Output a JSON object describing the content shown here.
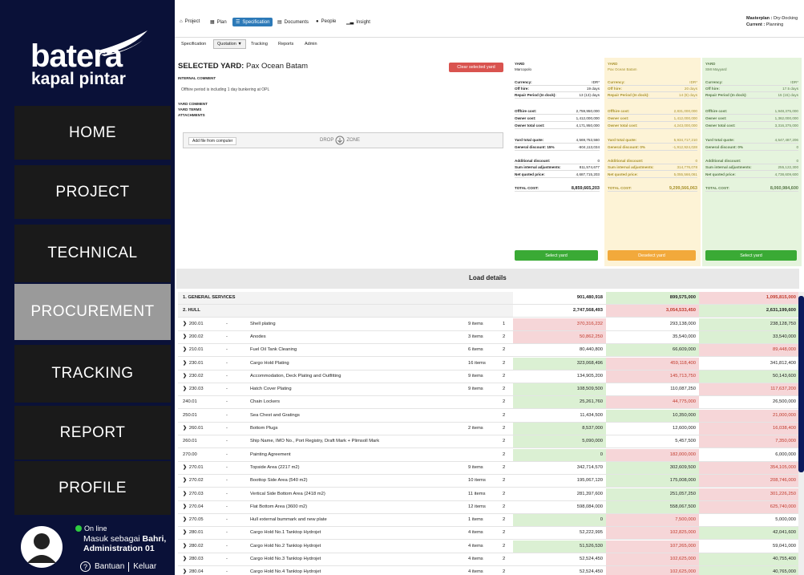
{
  "sidebar": {
    "logo_line1": "batera",
    "logo_line2": "kapal pintar",
    "items": [
      {
        "label": "HOME",
        "active": false
      },
      {
        "label": "PROJECT",
        "active": false
      },
      {
        "label": "TECHNICAL",
        "active": false
      },
      {
        "label": "PROCUREMENT",
        "active": true
      },
      {
        "label": "TRACKING",
        "active": false
      },
      {
        "label": "REPORT",
        "active": false
      },
      {
        "label": "PROFILE",
        "active": false
      }
    ],
    "user": {
      "status": "On line",
      "login_prefix": "Masuk sebagai",
      "login_name": "Bahri,",
      "login_role": "Administration 01",
      "help": "Bantuan",
      "logout": "Keluar"
    }
  },
  "topnav": {
    "tabs": [
      "Project",
      "Plan",
      "Specification",
      "Documents",
      "People",
      "Insight"
    ],
    "active": "Specification",
    "masterplan_label": "Masterplan :",
    "masterplan_value": "Dry-Docking",
    "current_label": "Current :",
    "current_value": "Planning"
  },
  "subtabs": [
    "Specification",
    "Quotation ▼",
    "Tracking",
    "Reports",
    "Admin"
  ],
  "left": {
    "selected_label": "SELECTED YARD:",
    "selected_value": "Pax Ocean Batam",
    "clear_button": "Clear selected yard",
    "internal_comment_label": "INTERNAL COMMENT",
    "internal_comment": "Offhire period is including 1 day bunkering at OPL",
    "yard_comment_label": "YARD COMMENT",
    "yard_terms_label": "YARD TERMS",
    "attachments_label": "ATTACHMENTS",
    "add_file": "Add file from computer",
    "drop_zone_left": "DROP",
    "drop_zone_right": "ZONE"
  },
  "yards": [
    {
      "label": "YARD",
      "name": "Marcopolo",
      "rows": [
        [
          "Currency:",
          "IDR*"
        ],
        [
          "Off hire:",
          "19 days"
        ],
        [
          "Repair Period (In dock):",
          "13 (13) days"
        ],
        [
          "Offhire cost:",
          "2,759,950,000"
        ],
        [
          "Owner cost:",
          "1,412,000,000"
        ],
        [
          "Owner total cost:",
          "4,171,950,000"
        ],
        [
          "Yard total quote:",
          "4,569,753,560"
        ],
        [
          "General discount: 15%",
          "-604,113,034"
        ],
        [
          "Additional discount:",
          "0"
        ],
        [
          "Sum internal adjustments:",
          "811,574,677"
        ],
        [
          "Net quoted price:",
          "4,687,715,203"
        ],
        [
          "TOTAL COST:",
          "8,859,665,203"
        ]
      ],
      "button": "Select yard"
    },
    {
      "label": "YARD",
      "name": "Pax Ocean Batam",
      "rows": [
        [
          "Currency:",
          "IDR*"
        ],
        [
          "Off hire:",
          "20 days"
        ],
        [
          "Repair Period (In dock):",
          "14 (8) days"
        ],
        [
          "Offhire cost:",
          "2,831,000,000"
        ],
        [
          "Owner cost:",
          "1,412,000,000"
        ],
        [
          "Owner total cost:",
          "4,243,000,000"
        ],
        [
          "Yard total quote:",
          "5,934,717,210"
        ],
        [
          "General discount: 0%",
          "-1,912,924,028"
        ],
        [
          "Additional discount:",
          "0"
        ],
        [
          "Sum internal adjustments:",
          "314,776,078"
        ],
        [
          "Net quoted price:",
          "5,055,566,061"
        ],
        [
          "TOTAL COST:",
          "9,299,566,063"
        ]
      ],
      "button": "Deselect yard"
    },
    {
      "label": "YARD",
      "name": "SMI Mayyard",
      "rows": [
        [
          "Currency:",
          "IDR*"
        ],
        [
          "Off hire:",
          "17.5 days"
        ],
        [
          "Repair Period (In dock):",
          "15 (15) days"
        ],
        [
          "Offhire cost:",
          "1,948,375,000"
        ],
        [
          "Owner cost:",
          "1,362,000,000"
        ],
        [
          "Owner total cost:",
          "3,316,375,000"
        ],
        [
          "Yard total quote:",
          "4,547,487,206"
        ],
        [
          "General discount: 0%",
          "0"
        ],
        [
          "Additional discount:",
          "0"
        ],
        [
          "Sum internal adjustments:",
          "255,122,300"
        ],
        [
          "Net quoted price:",
          "4,738,609,600"
        ],
        [
          "TOTAL COST:",
          "8,060,984,600"
        ]
      ],
      "button": "Select yard"
    }
  ],
  "load_details": "Load details",
  "table": {
    "rows": [
      {
        "type": "hdr",
        "code": "1. GENERAL SERVICES",
        "v": [
          "901,480,918",
          "899,575,000",
          "1,095,815,000"
        ],
        "c": [
          "wht",
          "grn",
          "red"
        ]
      },
      {
        "type": "hdr",
        "code": "2. HULL",
        "v": [
          "2,747,568,493",
          "3,054,533,450",
          "2,631,199,600"
        ],
        "c": [
          "wht",
          "red",
          "grn"
        ]
      },
      {
        "type": "row",
        "chev": true,
        "code": "200.01",
        "desc": "Shell plating",
        "items": "9 items",
        "cnt": "1",
        "v": [
          "370,316,232",
          "293,138,000",
          "238,128,750"
        ],
        "c": [
          "red",
          "wht",
          "grn"
        ]
      },
      {
        "type": "row",
        "chev": true,
        "code": "200.02",
        "desc": "Anodes",
        "items": "3 items",
        "cnt": "2",
        "v": [
          "50,862,250",
          "35,540,000",
          "33,540,000"
        ],
        "c": [
          "red",
          "wht",
          "grn"
        ]
      },
      {
        "type": "row",
        "chev": true,
        "code": "210.01",
        "desc": "Fuel Oil Tank Cleaning",
        "items": "6 items",
        "cnt": "2",
        "v": [
          "80,440,800",
          "66,609,000",
          "89,448,000"
        ],
        "c": [
          "wht",
          "grn",
          "red"
        ]
      },
      {
        "type": "row",
        "chev": true,
        "code": "230.01",
        "desc": "Cargo Hold Plating",
        "items": "16 items",
        "cnt": "2",
        "v": [
          "323,068,496",
          "459,118,400",
          "341,812,400"
        ],
        "c": [
          "grn",
          "red",
          "wht"
        ]
      },
      {
        "type": "row",
        "chev": true,
        "code": "230.02",
        "desc": "Accommodation, Deck Plating and Outfitting",
        "items": "9 items",
        "cnt": "2",
        "v": [
          "134,905,200",
          "145,713,750",
          "50,143,600"
        ],
        "c": [
          "wht",
          "red",
          "grn"
        ]
      },
      {
        "type": "row",
        "chev": true,
        "code": "230.03",
        "desc": "Hatch Cover Plating",
        "items": "9 items",
        "cnt": "2",
        "v": [
          "108,509,500",
          "110,087,250",
          "117,637,200"
        ],
        "c": [
          "grn",
          "wht",
          "red"
        ]
      },
      {
        "type": "row",
        "chev": false,
        "code": "240.01",
        "desc": "Chain Lockers",
        "items": "",
        "cnt": "2",
        "v": [
          "25,261,760",
          "44,775,000",
          "26,500,000"
        ],
        "c": [
          "grn",
          "red",
          "wht"
        ]
      },
      {
        "type": "row",
        "chev": false,
        "code": "250.01",
        "desc": "Sea Chest and Gratings",
        "items": "",
        "cnt": "2",
        "v": [
          "11,434,500",
          "10,350,000",
          "21,000,000"
        ],
        "c": [
          "wht",
          "grn",
          "red"
        ]
      },
      {
        "type": "row",
        "chev": true,
        "code": "260.01",
        "desc": "Bottom Plugs",
        "items": "2 items",
        "cnt": "2",
        "v": [
          "8,537,000",
          "12,600,000",
          "16,038,400"
        ],
        "c": [
          "grn",
          "wht",
          "red"
        ]
      },
      {
        "type": "row",
        "chev": false,
        "code": "260.01",
        "desc": "Ship Name, IMO No., Port Registry, Draft Mark + Plimsoll Mark",
        "items": "",
        "cnt": "2",
        "v": [
          "5,090,000",
          "5,457,500",
          "7,350,000"
        ],
        "c": [
          "grn",
          "wht",
          "red"
        ]
      },
      {
        "type": "row",
        "chev": false,
        "code": "270.00",
        "desc": "Painting Agreement",
        "items": "",
        "cnt": "2",
        "v": [
          "0",
          "182,000,000",
          "6,000,000"
        ],
        "c": [
          "grn",
          "red",
          "wht"
        ]
      },
      {
        "type": "row",
        "chev": true,
        "code": "270.01",
        "desc": "Topside Area (2217 m2)",
        "items": "9 items",
        "cnt": "2",
        "v": [
          "342,714,570",
          "302,609,500",
          "354,105,000"
        ],
        "c": [
          "wht",
          "grn",
          "red"
        ]
      },
      {
        "type": "row",
        "chev": true,
        "code": "270.02",
        "desc": "Boottop Side Area (540 m2)",
        "items": "10 items",
        "cnt": "2",
        "v": [
          "195,067,120",
          "175,008,000",
          "208,746,000"
        ],
        "c": [
          "wht",
          "grn",
          "red"
        ]
      },
      {
        "type": "row",
        "chev": true,
        "code": "270.03",
        "desc": "Vertical Side Bottom Area (2418 m2)",
        "items": "11 items",
        "cnt": "2",
        "v": [
          "281,397,600",
          "251,057,250",
          "301,226,250"
        ],
        "c": [
          "wht",
          "grn",
          "red"
        ]
      },
      {
        "type": "row",
        "chev": true,
        "code": "270.04",
        "desc": "Flat Bottom Area (3600 m2)",
        "items": "12 items",
        "cnt": "2",
        "v": [
          "598,084,000",
          "558,067,500",
          "625,740,000"
        ],
        "c": [
          "wht",
          "grn",
          "red"
        ]
      },
      {
        "type": "row",
        "chev": true,
        "code": "270.05",
        "desc": "Hull external bummark and new plate",
        "items": "1 items",
        "cnt": "2",
        "v": [
          "0",
          "7,500,000",
          "5,000,000"
        ],
        "c": [
          "grn",
          "red",
          "wht"
        ]
      },
      {
        "type": "row",
        "chev": true,
        "code": "280.01",
        "desc": "Cargo Hold No.1 Tanktop Hydrojet",
        "items": "4 items",
        "cnt": "2",
        "v": [
          "52,222,995",
          "102,825,000",
          "42,041,600"
        ],
        "c": [
          "wht",
          "red",
          "grn"
        ]
      },
      {
        "type": "row",
        "chev": true,
        "code": "280.02",
        "desc": "Cargo Hold No.2 Tanktop Hydrojet",
        "items": "4 items",
        "cnt": "2",
        "v": [
          "51,526,530",
          "107,265,000",
          "59,041,000"
        ],
        "c": [
          "grn",
          "red",
          "wht"
        ]
      },
      {
        "type": "row",
        "chev": true,
        "code": "280.03",
        "desc": "Cargo Hold No.3 Tanktop Hydrojet",
        "items": "4 items",
        "cnt": "2",
        "v": [
          "52,524,450",
          "102,625,000",
          "40,755,400"
        ],
        "c": [
          "wht",
          "red",
          "grn"
        ]
      },
      {
        "type": "row",
        "chev": true,
        "code": "280.04",
        "desc": "Cargo Hold No.4 Tanktop Hydrojet",
        "items": "4 items",
        "cnt": "2",
        "v": [
          "52,524,450",
          "102,625,000",
          "40,765,000"
        ],
        "c": [
          "wht",
          "red",
          "grn"
        ]
      }
    ]
  },
  "colors": {
    "sidebar": "#0a1138",
    "active_nav": "#9a9a9a",
    "accent": "#2d7ab8",
    "select": "#3aaa35",
    "deselect": "#f2a93b",
    "clear": "#d9534f"
  }
}
